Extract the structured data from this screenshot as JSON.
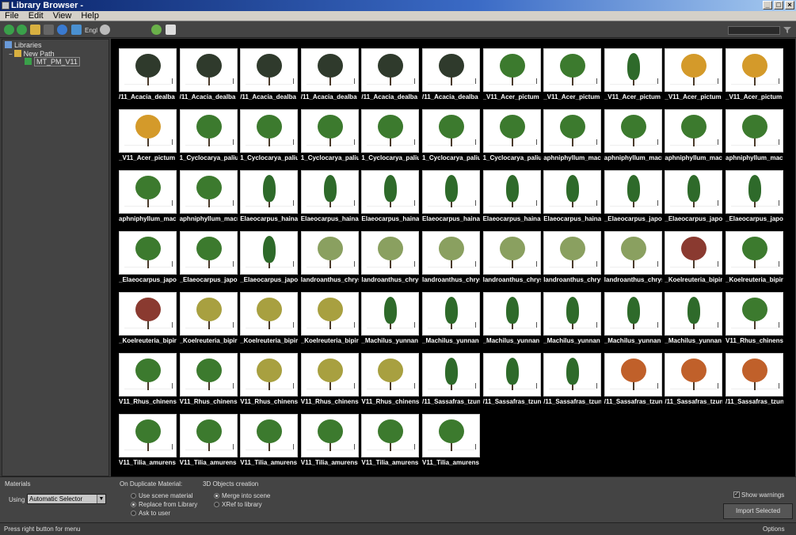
{
  "window": {
    "title": "Library Browser -"
  },
  "menu": [
    "File",
    "Edit",
    "View",
    "Help"
  ],
  "toolbar": {
    "language_label": "Engl"
  },
  "sidebar": {
    "root": "Libraries",
    "child": "New Path",
    "item": "MT_PM_V11"
  },
  "thumbnails": [
    {
      "label": "/11_Acacia_dealba",
      "kind": "dark"
    },
    {
      "label": "/11_Acacia_dealba",
      "kind": "dark"
    },
    {
      "label": "/11_Acacia_dealba",
      "kind": "dark"
    },
    {
      "label": "/11_Acacia_dealba",
      "kind": "dark"
    },
    {
      "label": "/11_Acacia_dealba",
      "kind": "dark"
    },
    {
      "label": "/11_Acacia_dealba",
      "kind": "dark"
    },
    {
      "label": "_V11_Acer_pictum",
      "kind": "green"
    },
    {
      "label": "_V11_Acer_pictum",
      "kind": "green"
    },
    {
      "label": "_V11_Acer_pictum",
      "kind": "conifer"
    },
    {
      "label": "_V11_Acer_pictum",
      "kind": "yellow"
    },
    {
      "label": "_V11_Acer_pictum",
      "kind": "yellow"
    },
    {
      "label": "_V11_Acer_pictum",
      "kind": "yellow"
    },
    {
      "label": "1_Cyclocarya_paliu",
      "kind": "green"
    },
    {
      "label": "1_Cyclocarya_paliu",
      "kind": "green"
    },
    {
      "label": "1_Cyclocarya_paliu",
      "kind": "green"
    },
    {
      "label": "1_Cyclocarya_paliu",
      "kind": "green"
    },
    {
      "label": "1_Cyclocarya_paliu",
      "kind": "green"
    },
    {
      "label": "1_Cyclocarya_paliu",
      "kind": "green"
    },
    {
      "label": "aphniphyllum_macr",
      "kind": "green"
    },
    {
      "label": "aphniphyllum_macr",
      "kind": "green"
    },
    {
      "label": "aphniphyllum_macr",
      "kind": "green"
    },
    {
      "label": "aphniphyllum_macr",
      "kind": "green"
    },
    {
      "label": "aphniphyllum_macr",
      "kind": "green"
    },
    {
      "label": "aphniphyllum_macr",
      "kind": "green"
    },
    {
      "label": "Elaeocarpus_haina",
      "kind": "conifer"
    },
    {
      "label": "Elaeocarpus_haina",
      "kind": "conifer"
    },
    {
      "label": "Elaeocarpus_haina",
      "kind": "conifer"
    },
    {
      "label": "Elaeocarpus_haina",
      "kind": "conifer"
    },
    {
      "label": "Elaeocarpus_haina",
      "kind": "conifer"
    },
    {
      "label": "Elaeocarpus_haina",
      "kind": "conifer"
    },
    {
      "label": "_Elaeocarpus_japo",
      "kind": "conifer"
    },
    {
      "label": "_Elaeocarpus_japo",
      "kind": "conifer"
    },
    {
      "label": "_Elaeocarpus_japo",
      "kind": "conifer"
    },
    {
      "label": "_Elaeocarpus_japo",
      "kind": "green"
    },
    {
      "label": "_Elaeocarpus_japo",
      "kind": "green"
    },
    {
      "label": "_Elaeocarpus_japo",
      "kind": "conifer"
    },
    {
      "label": "landroanthus_chrys",
      "kind": "light"
    },
    {
      "label": "landroanthus_chrys",
      "kind": "light"
    },
    {
      "label": "landroanthus_chrys",
      "kind": "light"
    },
    {
      "label": "landroanthus_chrys",
      "kind": "light"
    },
    {
      "label": "landroanthus_chrys",
      "kind": "light"
    },
    {
      "label": "landroanthus_chrys",
      "kind": "light"
    },
    {
      "label": "_Koelreuteria_bipir",
      "kind": "red"
    },
    {
      "label": "_Koelreuteria_bipir",
      "kind": "green"
    },
    {
      "label": "_Koelreuteria_bipir",
      "kind": "red"
    },
    {
      "label": "_Koelreuteria_bipir",
      "kind": "olive"
    },
    {
      "label": "_Koelreuteria_bipir",
      "kind": "olive"
    },
    {
      "label": "_Koelreuteria_bipir",
      "kind": "olive"
    },
    {
      "label": "_Machilus_yunnan",
      "kind": "conifer"
    },
    {
      "label": "_Machilus_yunnan",
      "kind": "conifer"
    },
    {
      "label": "_Machilus_yunnan",
      "kind": "conifer"
    },
    {
      "label": "_Machilus_yunnan",
      "kind": "conifer"
    },
    {
      "label": "_Machilus_yunnan",
      "kind": "conifer"
    },
    {
      "label": "_Machilus_yunnan",
      "kind": "conifer"
    },
    {
      "label": "V11_Rhus_chinens",
      "kind": "green"
    },
    {
      "label": "V11_Rhus_chinens",
      "kind": "green"
    },
    {
      "label": "V11_Rhus_chinens",
      "kind": "green"
    },
    {
      "label": "V11_Rhus_chinens",
      "kind": "olive"
    },
    {
      "label": "V11_Rhus_chinens",
      "kind": "olive"
    },
    {
      "label": "V11_Rhus_chinens",
      "kind": "olive"
    },
    {
      "label": "/11_Sassafras_tzun",
      "kind": "conifer"
    },
    {
      "label": "/11_Sassafras_tzun",
      "kind": "conifer"
    },
    {
      "label": "/11_Sassafras_tzun",
      "kind": "conifer"
    },
    {
      "label": "/11_Sassafras_tzun",
      "kind": "orange"
    },
    {
      "label": "/11_Sassafras_tzun",
      "kind": "orange"
    },
    {
      "label": "/11_Sassafras_tzun",
      "kind": "orange"
    },
    {
      "label": "V11_Tilia_amurens",
      "kind": "green"
    },
    {
      "label": "V11_Tilia_amurens",
      "kind": "green"
    },
    {
      "label": "V11_Tilia_amurens",
      "kind": "green"
    },
    {
      "label": "V11_Tilia_amurens",
      "kind": "green"
    },
    {
      "label": "V11_Tilia_amurens",
      "kind": "green"
    },
    {
      "label": "V11_Tilia_amurens",
      "kind": "green"
    }
  ],
  "tree_colors": {
    "dark": "#2f3a2c",
    "green": "#3c7a2e",
    "conifer": "#2e6a2a",
    "yellow": "#d49a2a",
    "light": "#8aa060",
    "red": "#8a3a30",
    "olive": "#a8a040",
    "orange": "#c0602a"
  },
  "bottom": {
    "materials_title": "Materials",
    "using_label": "Using",
    "using_value": "Automatic Selector",
    "dup_title": "On Duplicate Material:",
    "dup_options": [
      "Use scene material",
      "Replace from Library",
      "Ask to user"
    ],
    "objects_title": "3D Objects creation",
    "object_options": [
      "Merge into scene",
      "XRef to library"
    ],
    "show_warnings": "Show warnings",
    "import_button": "Import Selected"
  },
  "status": {
    "text": "Press right button for menu",
    "options": "Options"
  }
}
